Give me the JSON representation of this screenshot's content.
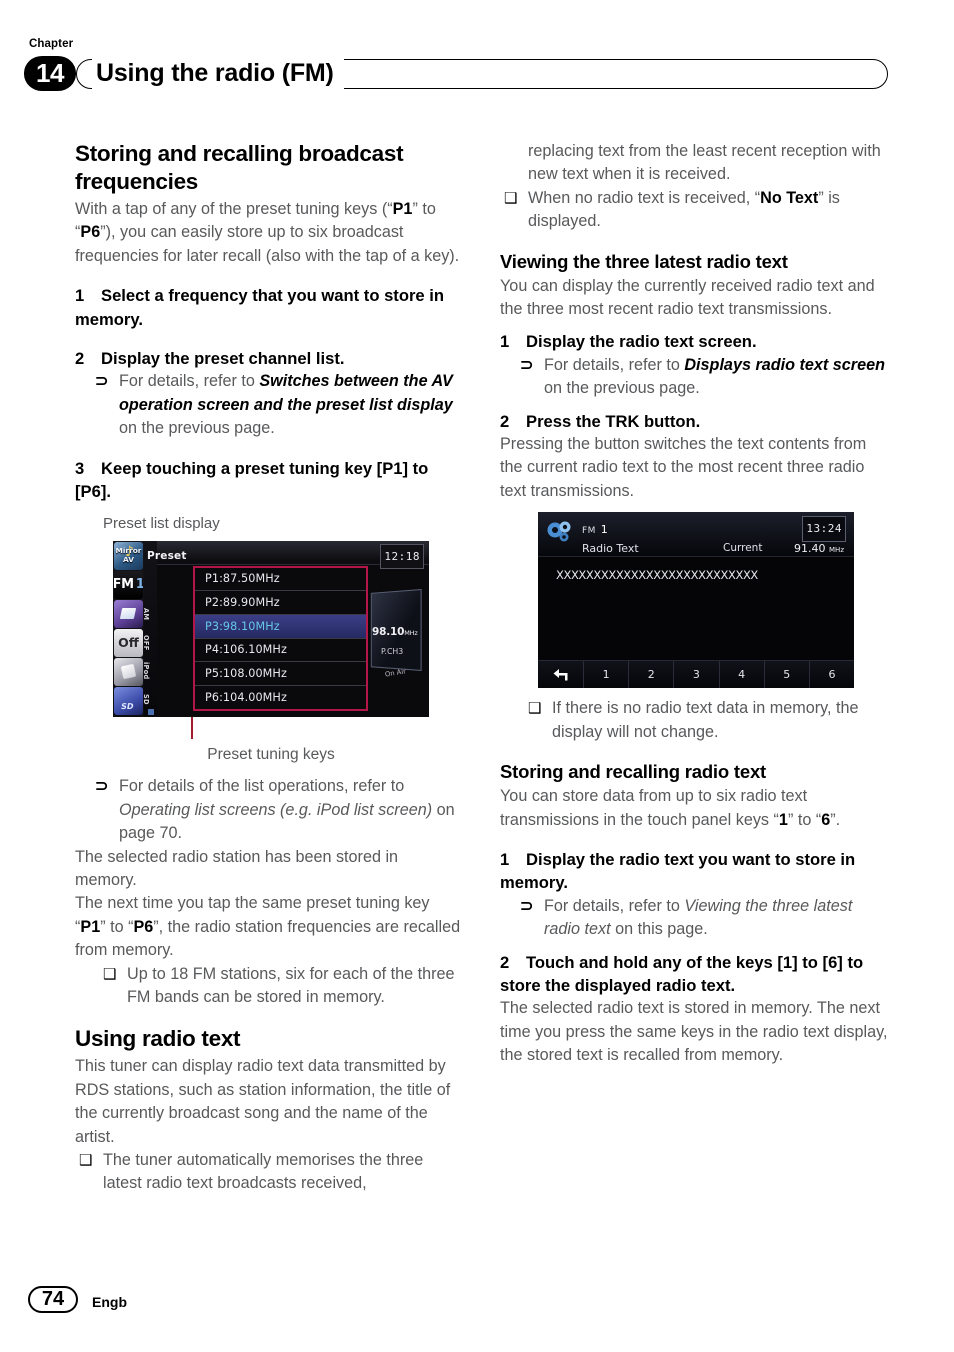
{
  "header": {
    "chapter_label": "Chapter",
    "chapter_number": "14",
    "title": "Using the radio (FM)"
  },
  "footer": {
    "page_number": "74",
    "language": "Engb"
  },
  "colors": {
    "callout": "#9e1b32",
    "list_highlight": "#66c7ea",
    "body_text": "#58595b"
  },
  "left_column": {
    "section_title": "Storing and recalling broadcast frequencies",
    "intro_a": "With a tap of any of the preset tuning keys (“",
    "intro_p1": "P1",
    "intro_b": "” to “",
    "intro_p6": "P6",
    "intro_c": "”), you can easily store up to six broadcast frequencies for later recall (also with the tap of a key).",
    "step1_num": "1",
    "step1_text": "Select a frequency that you want to store in memory.",
    "step2_num": "2",
    "step2_text": "Display the preset channel list.",
    "step2_note_marker": "⊃",
    "step2_note_a": "For details, refer to ",
    "step2_note_ref": "Switches between the AV operation screen and the preset list display",
    "step2_note_b": " on the previous page.",
    "step3_num": "3",
    "step3_text": "Keep touching a preset tuning key [P1] to [P6].",
    "figure_caption_top": "Preset list display",
    "figure_caption_bottom": "Preset tuning keys",
    "note_list_marker": "⊃",
    "note_list_a": "For details of the list operations, refer to ",
    "note_list_ref": "Operating list screens (e.g. iPod list screen)",
    "note_list_b": " on page 70.",
    "para_stored": "The selected radio station has been stored in memory.",
    "para_next_a": "The next time you tap the same preset tuning key “",
    "para_next_p1": "P1",
    "para_next_b": "” to “",
    "para_next_p6": "P6",
    "para_next_c": "”, the radio station frequencies are recalled from memory.",
    "note_18fm_marker": "❑",
    "note_18fm": "Up to 18 FM stations, six for each of the three FM bands can be stored in memory.",
    "section2_title": "Using radio text",
    "section2_body": "This tuner can display radio text data transmitted by RDS stations, such as station information, the title of the currently broadcast song and the name of the artist.",
    "note_memorise_marker": "❑",
    "note_memorise": "The tuner automatically memorises the three latest radio text broadcasts received,"
  },
  "right_column": {
    "cont_text": "replacing text from the least recent reception with new text when it is received.",
    "note_notext_marker": "❑",
    "note_notext_a": "When no radio text is received, “",
    "note_notext_bold": "No Text",
    "note_notext_b": "” is displayed.",
    "sub1_title": "Viewing the three latest radio text",
    "sub1_body": "You can display the currently received radio text and the three most recent radio text transmissions.",
    "step1_num": "1",
    "step1_text": "Display the radio text screen.",
    "step1_note_marker": "⊃",
    "step1_note_a": "For details, refer to ",
    "step1_note_ref": "Displays radio text screen",
    "step1_note_b": " on the previous page.",
    "step2_num": "2",
    "step2_text": "Press the TRK button.",
    "step2_body": "Pressing the button switches the text contents from the current radio text to the most recent three radio text transmissions.",
    "note_nodata_marker": "❑",
    "note_nodata": "If there is no radio text data in memory, the display will not change.",
    "sub2_title": "Storing and recalling radio text",
    "sub2_body_a": "You can store data from up to six radio text transmissions in the touch panel keys “",
    "sub2_body_key1": "1",
    "sub2_body_b": "” to “",
    "sub2_body_key6": "6",
    "sub2_body_c": "”.",
    "s2_step1_num": "1",
    "s2_step1_text": "Display the radio text you want to store in memory.",
    "s2_step1_note_marker": "⊃",
    "s2_step1_note_a": "For details, refer to ",
    "s2_step1_note_ref": "Viewing the three latest radio text",
    "s2_step1_note_b": " on this page.",
    "s2_step2_num": "2",
    "s2_step2_text": "Touch and hold any of the keys [1] to [6] to store the displayed radio text.",
    "s2_step2_body": "The selected radio text is stored in memory. The next time you press the same keys in the radio text display, the stored text is recalled from memory."
  },
  "preset_display": {
    "title": "Preset",
    "clock": "12:18",
    "sidebar": {
      "mirror_line1": "Mirror",
      "mirror_line2": "AV",
      "fm_label": "FM",
      "fm_band": "1",
      "off_label": "Off",
      "tab_am": "AM",
      "tab_off": "OFF",
      "tab_ipod": "iPod",
      "tab_sd": "SD"
    },
    "rows": [
      {
        "label": "P1:87.50MHz",
        "selected": false
      },
      {
        "label": "P2:89.90MHz",
        "selected": false
      },
      {
        "label": "P3:98.10MHz",
        "selected": true
      },
      {
        "label": "P4:106.10MHz",
        "selected": false
      },
      {
        "label": "P5:108.00MHz",
        "selected": false
      },
      {
        "label": "P6:104.00MHz",
        "selected": false
      }
    ],
    "panel": {
      "frequency": "98.10",
      "unit": "MHz",
      "preset_channel": "P.CH3",
      "on_air": "On Air"
    }
  },
  "radiotext_display": {
    "band": "FM",
    "band_number": "1",
    "label": "Radio Text",
    "current_label": "Current",
    "frequency": "91.40",
    "unit": "MHz",
    "clock": "13:24",
    "text_body": "XXXXXXXXXXXXXXXXXXXXXXXXXXX",
    "back_icon": "↩",
    "keys": [
      "1",
      "2",
      "3",
      "4",
      "5",
      "6"
    ]
  }
}
